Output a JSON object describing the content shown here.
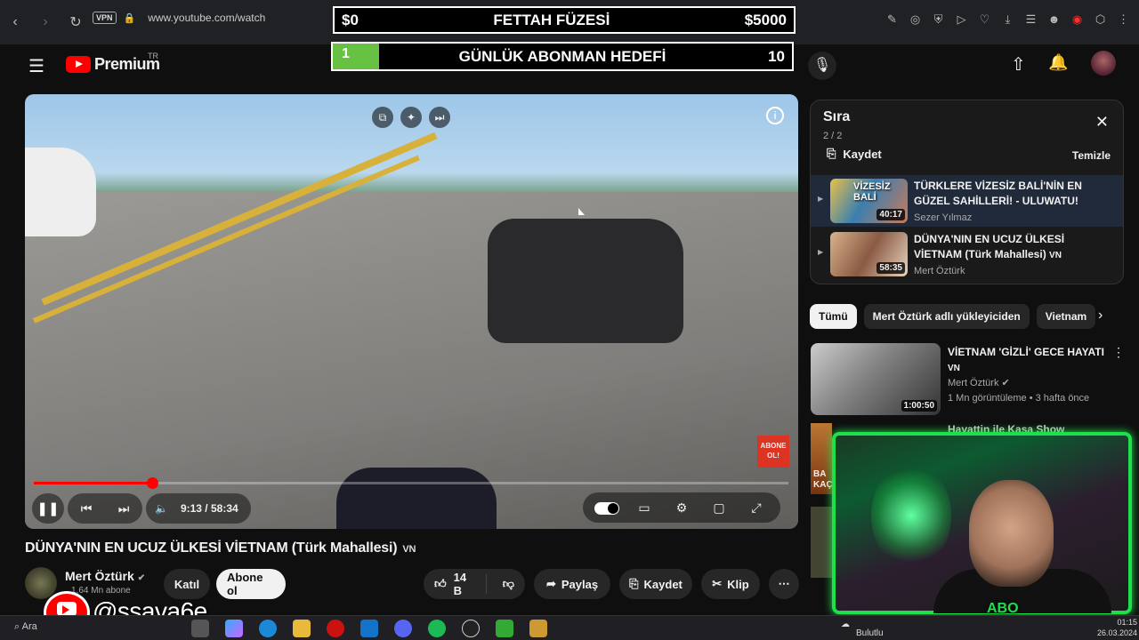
{
  "browser": {
    "url": "www.youtube.com/watch",
    "vpn_label": "VPN"
  },
  "overlay": {
    "left_amount": "$0",
    "title": "FETTAH FÜZESİ",
    "right_amount": "$5000",
    "goal_current": "1",
    "goal_title": "GÜNLÜK ABONMAN HEDEFİ",
    "goal_target": "10",
    "goal_progress": 0.1
  },
  "header": {
    "logo_text": "Premium",
    "region": "TR"
  },
  "player": {
    "time": "9:13 / 58:34",
    "progress": 0.157,
    "subscribe_badge": "ABONE OL!"
  },
  "video": {
    "title": "DÜNYA'NIN EN UCUZ ÜLKESİ VİETNAM (Türk Mahallesi)",
    "title_tag": "VN",
    "channel": "Mert Öztürk",
    "subscribers": "1,64 Mn abone",
    "join_label": "Katıl",
    "subscribe_label": "Abone ol",
    "likes": "14 B",
    "share_label": "Paylaş",
    "save_label": "Kaydet",
    "clip_label": "Klip"
  },
  "playlist": {
    "title": "Sıra",
    "count": "2 / 2",
    "save_label": "Kaydet",
    "clear_label": "Temizle",
    "items": [
      {
        "title": "TÜRKLERE VİZESİZ BALİ'NİN EN GÜZEL SAHİLLERİ! - ULUWATU!",
        "channel": "Sezer Yılmaz",
        "duration": "40:17",
        "thumb_text": "VİZESİZ BALİ"
      },
      {
        "title": "DÜNYA'NIN EN UCUZ ÜLKESİ VİETNAM (Türk Mahallesi)",
        "title_tag": "VN",
        "channel": "Mert Öztürk",
        "duration": "58:35"
      }
    ]
  },
  "chips": [
    "Tümü",
    "Mert Öztürk adlı yükleyiciden",
    "Vietnam"
  ],
  "recommended": [
    {
      "title": "VİETNAM 'GİZLİ' GECE HAYATI",
      "title_tag": "VN",
      "channel": "Mert Öztürk",
      "meta": "1 Mn görüntüleme • 3 hafta önce",
      "duration": "1:00:50"
    },
    {
      "title": "Hayattin ile Kasa Show",
      "overlay_text": "BA KAÇ"
    }
  ],
  "webcam": {
    "logo": "ABO"
  },
  "watermark": {
    "handle": "@ssava6e"
  },
  "taskbar": {
    "search": "Ara",
    "weather": "Bulutlu",
    "time": "01:15",
    "date": "26.03.2024"
  },
  "colors": {
    "yt_red": "#ff0000",
    "goal_green": "#67c142",
    "webcam_border": "#1ee04a"
  }
}
